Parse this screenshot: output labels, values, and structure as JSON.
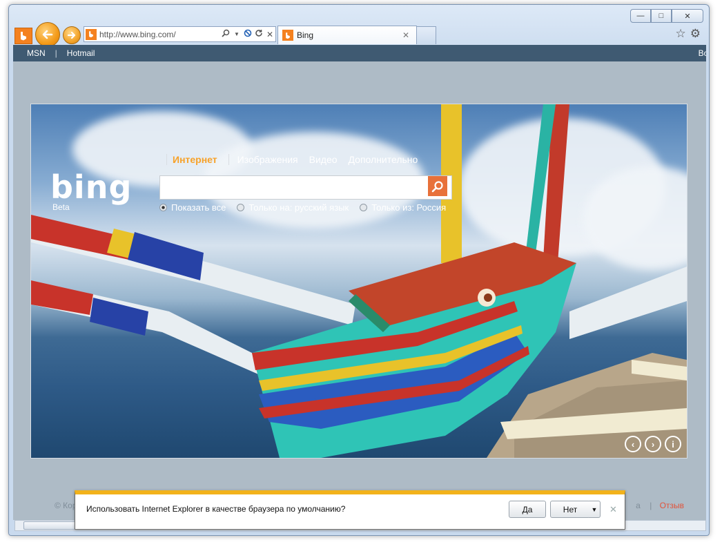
{
  "browser": {
    "address_url": "http://www.bing.com/",
    "tab_title": "Bing",
    "window_controls": {
      "minimize": "—",
      "maximize": "□",
      "close": "✕"
    },
    "icons": [
      "back-arrow-icon",
      "forward-arrow-icon",
      "search-icon",
      "dropdown-icon",
      "stop-icon",
      "refresh-icon",
      "close-icon",
      "star-icon",
      "gear-icon"
    ]
  },
  "links_bar": {
    "msn": "MSN",
    "separator": "|",
    "hotmail": "Hotmail",
    "signin_partial": "Вой"
  },
  "bing": {
    "logo": "bing",
    "beta": "Beta",
    "nav": {
      "internet": "Интернет",
      "images": "Изображения",
      "video": "Видео",
      "more": "Дополнительно"
    },
    "search_value": "",
    "radios": [
      {
        "label": "Показать все",
        "checked": true
      },
      {
        "label": "Только на: русский язык",
        "checked": false
      },
      {
        "label": "Только из: Россия",
        "checked": false
      }
    ],
    "hero_controls": {
      "prev": "‹",
      "next": "›",
      "info": "i"
    }
  },
  "footer": {
    "copyright_partial": "© Корп",
    "right_partial": "а",
    "sep": "|",
    "feedback": "Отзыв"
  },
  "infobar": {
    "message": "Использовать Internet Explorer в качестве браузера по умолчанию?",
    "yes": "Да",
    "no": "Нет",
    "dropdown": "▼",
    "close": "✕"
  },
  "colors": {
    "accent_orange": "#f7a229",
    "infobar_top": "#f2b21b",
    "feedback_red": "#e2533a"
  }
}
